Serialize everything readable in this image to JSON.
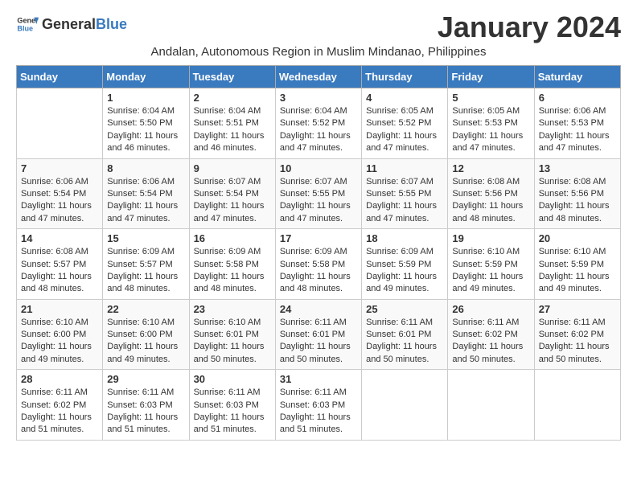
{
  "header": {
    "logo_general": "General",
    "logo_blue": "Blue",
    "title": "January 2024",
    "subtitle": "Andalan, Autonomous Region in Muslim Mindanao, Philippines"
  },
  "days_of_week": [
    "Sunday",
    "Monday",
    "Tuesday",
    "Wednesday",
    "Thursday",
    "Friday",
    "Saturday"
  ],
  "weeks": [
    [
      {
        "day": "",
        "info": ""
      },
      {
        "day": "1",
        "info": "Sunrise: 6:04 AM\nSunset: 5:50 PM\nDaylight: 11 hours and 46 minutes."
      },
      {
        "day": "2",
        "info": "Sunrise: 6:04 AM\nSunset: 5:51 PM\nDaylight: 11 hours and 46 minutes."
      },
      {
        "day": "3",
        "info": "Sunrise: 6:04 AM\nSunset: 5:52 PM\nDaylight: 11 hours and 47 minutes."
      },
      {
        "day": "4",
        "info": "Sunrise: 6:05 AM\nSunset: 5:52 PM\nDaylight: 11 hours and 47 minutes."
      },
      {
        "day": "5",
        "info": "Sunrise: 6:05 AM\nSunset: 5:53 PM\nDaylight: 11 hours and 47 minutes."
      },
      {
        "day": "6",
        "info": "Sunrise: 6:06 AM\nSunset: 5:53 PM\nDaylight: 11 hours and 47 minutes."
      }
    ],
    [
      {
        "day": "7",
        "info": "Sunrise: 6:06 AM\nSunset: 5:54 PM\nDaylight: 11 hours and 47 minutes."
      },
      {
        "day": "8",
        "info": "Sunrise: 6:06 AM\nSunset: 5:54 PM\nDaylight: 11 hours and 47 minutes."
      },
      {
        "day": "9",
        "info": "Sunrise: 6:07 AM\nSunset: 5:54 PM\nDaylight: 11 hours and 47 minutes."
      },
      {
        "day": "10",
        "info": "Sunrise: 6:07 AM\nSunset: 5:55 PM\nDaylight: 11 hours and 47 minutes."
      },
      {
        "day": "11",
        "info": "Sunrise: 6:07 AM\nSunset: 5:55 PM\nDaylight: 11 hours and 47 minutes."
      },
      {
        "day": "12",
        "info": "Sunrise: 6:08 AM\nSunset: 5:56 PM\nDaylight: 11 hours and 48 minutes."
      },
      {
        "day": "13",
        "info": "Sunrise: 6:08 AM\nSunset: 5:56 PM\nDaylight: 11 hours and 48 minutes."
      }
    ],
    [
      {
        "day": "14",
        "info": "Sunrise: 6:08 AM\nSunset: 5:57 PM\nDaylight: 11 hours and 48 minutes."
      },
      {
        "day": "15",
        "info": "Sunrise: 6:09 AM\nSunset: 5:57 PM\nDaylight: 11 hours and 48 minutes."
      },
      {
        "day": "16",
        "info": "Sunrise: 6:09 AM\nSunset: 5:58 PM\nDaylight: 11 hours and 48 minutes."
      },
      {
        "day": "17",
        "info": "Sunrise: 6:09 AM\nSunset: 5:58 PM\nDaylight: 11 hours and 48 minutes."
      },
      {
        "day": "18",
        "info": "Sunrise: 6:09 AM\nSunset: 5:59 PM\nDaylight: 11 hours and 49 minutes."
      },
      {
        "day": "19",
        "info": "Sunrise: 6:10 AM\nSunset: 5:59 PM\nDaylight: 11 hours and 49 minutes."
      },
      {
        "day": "20",
        "info": "Sunrise: 6:10 AM\nSunset: 5:59 PM\nDaylight: 11 hours and 49 minutes."
      }
    ],
    [
      {
        "day": "21",
        "info": "Sunrise: 6:10 AM\nSunset: 6:00 PM\nDaylight: 11 hours and 49 minutes."
      },
      {
        "day": "22",
        "info": "Sunrise: 6:10 AM\nSunset: 6:00 PM\nDaylight: 11 hours and 49 minutes."
      },
      {
        "day": "23",
        "info": "Sunrise: 6:10 AM\nSunset: 6:01 PM\nDaylight: 11 hours and 50 minutes."
      },
      {
        "day": "24",
        "info": "Sunrise: 6:11 AM\nSunset: 6:01 PM\nDaylight: 11 hours and 50 minutes."
      },
      {
        "day": "25",
        "info": "Sunrise: 6:11 AM\nSunset: 6:01 PM\nDaylight: 11 hours and 50 minutes."
      },
      {
        "day": "26",
        "info": "Sunrise: 6:11 AM\nSunset: 6:02 PM\nDaylight: 11 hours and 50 minutes."
      },
      {
        "day": "27",
        "info": "Sunrise: 6:11 AM\nSunset: 6:02 PM\nDaylight: 11 hours and 50 minutes."
      }
    ],
    [
      {
        "day": "28",
        "info": "Sunrise: 6:11 AM\nSunset: 6:02 PM\nDaylight: 11 hours and 51 minutes."
      },
      {
        "day": "29",
        "info": "Sunrise: 6:11 AM\nSunset: 6:03 PM\nDaylight: 11 hours and 51 minutes."
      },
      {
        "day": "30",
        "info": "Sunrise: 6:11 AM\nSunset: 6:03 PM\nDaylight: 11 hours and 51 minutes."
      },
      {
        "day": "31",
        "info": "Sunrise: 6:11 AM\nSunset: 6:03 PM\nDaylight: 11 hours and 51 minutes."
      },
      {
        "day": "",
        "info": ""
      },
      {
        "day": "",
        "info": ""
      },
      {
        "day": "",
        "info": ""
      }
    ]
  ]
}
